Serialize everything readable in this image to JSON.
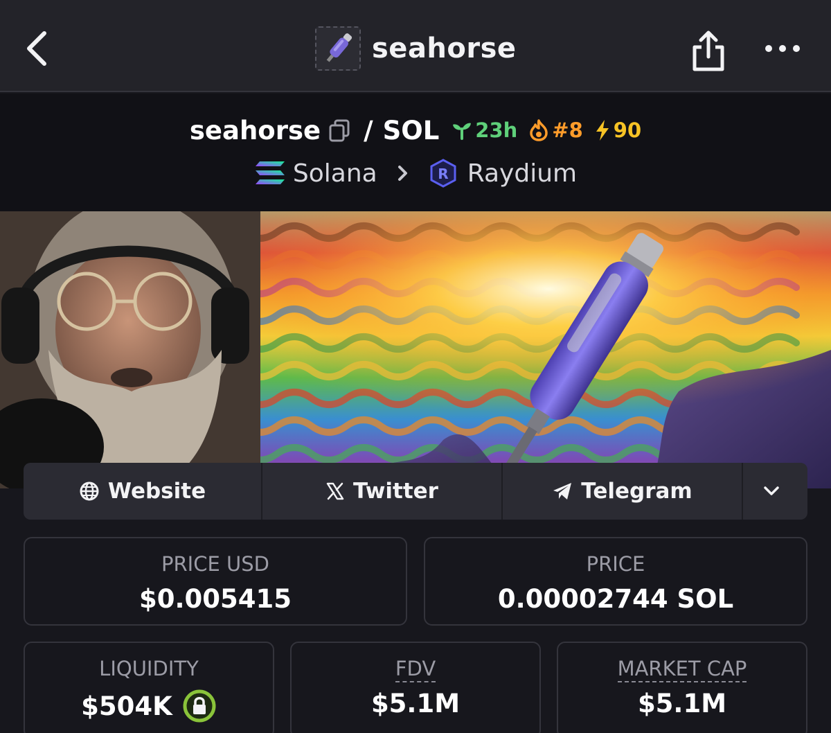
{
  "header": {
    "title": "seahorse",
    "back_icon": "chevron-left-icon",
    "share_icon": "share-icon",
    "more_icon": "more-horizontal-icon"
  },
  "pair": {
    "base": "seahorse",
    "slash": "/",
    "quote": "SOL",
    "age": "23h",
    "rank": "#8",
    "boosts": "90",
    "chain": "Solana",
    "dex": "Raydium",
    "colors": {
      "age": "#5fd07a",
      "rank": "#ff9c2a",
      "boost": "#f7c325"
    }
  },
  "links": {
    "website": "Website",
    "twitter": "Twitter",
    "telegram": "Telegram"
  },
  "stats": {
    "price_usd_label": "PRICE USD",
    "price_usd": "$0.005415",
    "price_label": "PRICE",
    "price": "0.00002744 SOL",
    "liquidity_label": "LIQUIDITY",
    "liquidity": "$504K",
    "fdv_label": "FDV",
    "fdv": "$5.1M",
    "mcap_label": "MARKET CAP",
    "mcap": "$5.1M"
  }
}
